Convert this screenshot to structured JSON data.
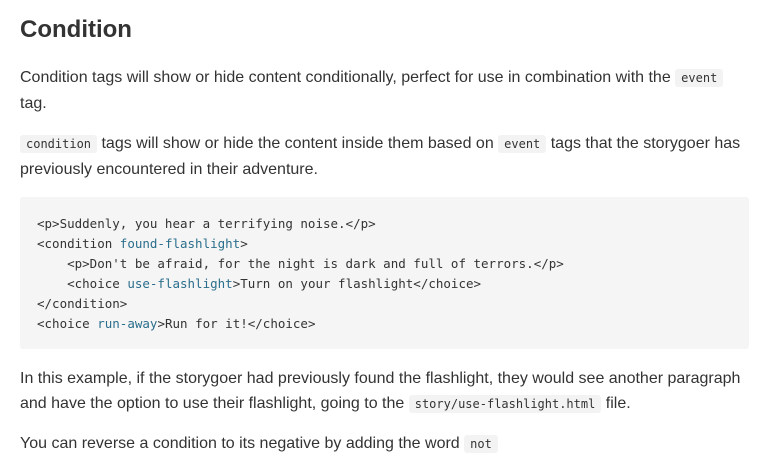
{
  "heading": "Condition",
  "para1": {
    "text_a": "Condition tags will show or hide content conditionally, perfect for use in combination with the ",
    "code": "event",
    "text_b": " tag."
  },
  "para2": {
    "code_a": "condition",
    "text_a": " tags will show or hide the content inside them based on ",
    "code_b": "event",
    "text_b": " tags that the storygoer has previously encountered in their adventure."
  },
  "code_block": {
    "lines": [
      {
        "indent": "",
        "pre": "<p>Suddenly, you hear a terrifying noise.</p>",
        "attr": "",
        "post": ""
      },
      {
        "indent": "",
        "pre": "<condition ",
        "attr": "found-flashlight",
        "post": ">"
      },
      {
        "indent": "    ",
        "pre": "<p>Don't be afraid, for the night is dark and full of terrors.</p>",
        "attr": "",
        "post": ""
      },
      {
        "indent": "    ",
        "pre": "<choice ",
        "attr": "use-flashlight",
        "post": ">Turn on your flashlight</choice>"
      },
      {
        "indent": "",
        "pre": "</condition>",
        "attr": "",
        "post": ""
      },
      {
        "indent": "",
        "pre": "<choice ",
        "attr": "run-away",
        "post": ">Run for it!</choice>"
      }
    ]
  },
  "para3": {
    "text_a": "In this example, if the storygoer had previously found the flashlight, they would see another paragraph and have the option to use their flashlight, going to the ",
    "code": "story/use-flashlight.html",
    "text_b": " file."
  },
  "para4": {
    "text_a": "You can reverse a condition to its negative by adding the word ",
    "code": "not"
  }
}
